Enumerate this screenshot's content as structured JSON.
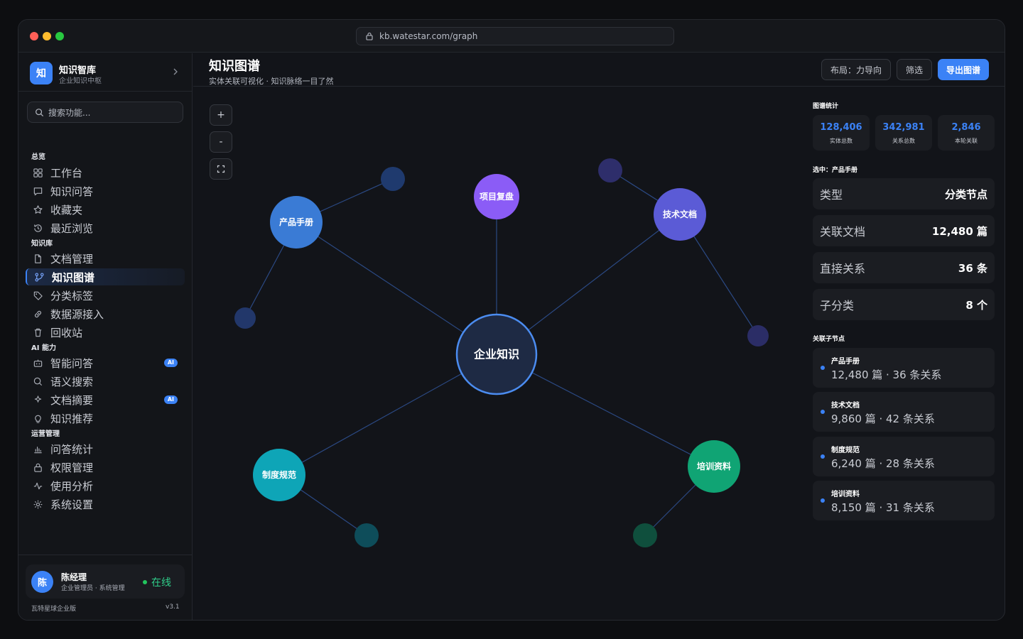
{
  "browser": {
    "url": "kb.watestar.com/graph"
  },
  "brand": {
    "logo": "知",
    "name": "知识智库",
    "subtitle": "企业知识中枢"
  },
  "search": {
    "placeholder": "搜索功能..."
  },
  "sections": {
    "overview": "总览",
    "library": "知识库",
    "ai": "AI 能力",
    "ops": "运营管理"
  },
  "nav": {
    "overview": [
      {
        "label": "工作台",
        "icon": "grid-icon"
      },
      {
        "label": "知识问答",
        "icon": "chat-icon"
      },
      {
        "label": "收藏夹",
        "icon": "star-icon"
      },
      {
        "label": "最近浏览",
        "icon": "history-icon"
      }
    ],
    "library": [
      {
        "label": "文档管理",
        "icon": "document-icon"
      },
      {
        "label": "知识图谱",
        "icon": "graph-icon",
        "active": true
      },
      {
        "label": "分类标签",
        "icon": "tag-icon"
      },
      {
        "label": "数据源接入",
        "icon": "link-icon"
      },
      {
        "label": "回收站",
        "icon": "trash-icon"
      }
    ],
    "ai": [
      {
        "label": "智能问答",
        "icon": "robot-icon",
        "badge": "AI"
      },
      {
        "label": "语义搜索",
        "icon": "search-icon"
      },
      {
        "label": "文档摘要",
        "icon": "sparkle-icon",
        "badge": "AI"
      },
      {
        "label": "知识推荐",
        "icon": "bulb-icon"
      }
    ],
    "ops": [
      {
        "label": "问答统计",
        "icon": "bar-chart-icon"
      },
      {
        "label": "权限管理",
        "icon": "lock-icon"
      },
      {
        "label": "使用分析",
        "icon": "activity-icon"
      },
      {
        "label": "系统设置",
        "icon": "gear-icon"
      }
    ]
  },
  "user": {
    "avatar": "陈",
    "name": "陈经理",
    "role": "企业管理员 · 系统管理",
    "status": "在线"
  },
  "footer": {
    "edition": "瓦特星球企业版",
    "version": "v3.1"
  },
  "header": {
    "title": "知识图谱",
    "subtitle": "实体关联可视化 · 知识脉络一目了然",
    "layout_btn": "布局：力导向",
    "filter_btn": "筛选",
    "export_btn": "导出图谱"
  },
  "zoom": {
    "in": "+",
    "out": "-"
  },
  "graph": {
    "center": "企业知识",
    "nodes": {
      "product": "产品手册",
      "review": "项目复盘",
      "tech": "技术文档",
      "policy": "制度规范",
      "training": "培训资料"
    },
    "colors": {
      "center": "#1e2a44",
      "product": "#3a7bd5",
      "review": "#8b5cf6",
      "tech": "#5b5bd6",
      "policy": "#0ea5b7",
      "training": "#10a474"
    }
  },
  "panel": {
    "stats_title": "图谱统计",
    "stats": [
      {
        "value": "128,406",
        "label": "实体总数"
      },
      {
        "value": "342,981",
        "label": "关系总数"
      },
      {
        "value": "2,846",
        "label": "本轮关联"
      }
    ],
    "selected_title": "选中：产品手册",
    "props": [
      {
        "key": "类型",
        "value": "分类节点"
      },
      {
        "key": "关联文档",
        "value": "12,480 篇"
      },
      {
        "key": "直接关系",
        "value": "36 条"
      },
      {
        "key": "子分类",
        "value": "8 个"
      }
    ],
    "children_title": "关联子节点",
    "children": [
      {
        "name": "产品手册",
        "desc": "12,480 篇 · 36 条关系"
      },
      {
        "name": "技术文档",
        "desc": "9,860 篇 · 42 条关系"
      },
      {
        "name": "制度规范",
        "desc": "6,240 篇 · 28 条关系"
      },
      {
        "name": "培训资料",
        "desc": "8,150 篇 · 31 条关系"
      }
    ]
  }
}
